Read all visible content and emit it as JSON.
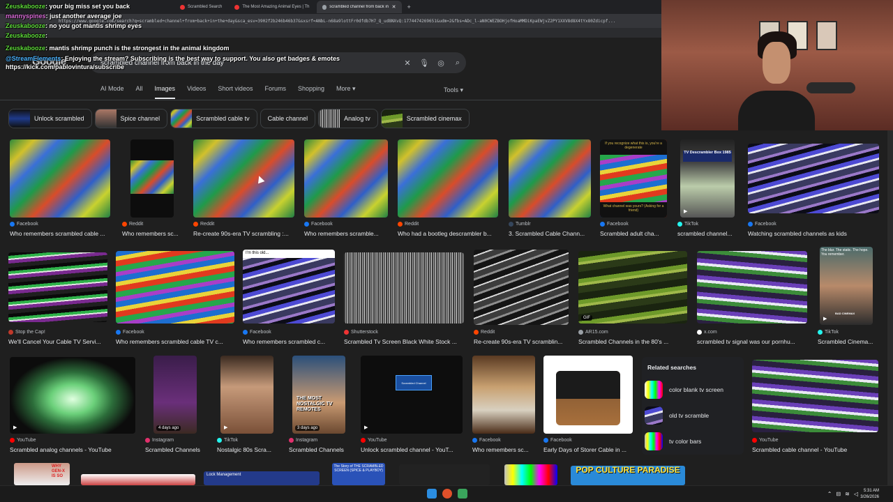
{
  "browser": {
    "tabs": [
      {
        "label": "Scrambled Search"
      },
      {
        "label": "The Most Amazing Animal Eyes | Th"
      },
      {
        "label": "scrambled channel from back in"
      }
    ],
    "url": "https://www.google.com/search?q=scrambled+channel+from+back+in+the+day&sca_esv=3902f2b246b46b37&sxsrf=ANbL-n68a9lottFr0dfdb7H7_Q_ud8NXvQ:1774474269651&udm=2&fbs=ADc_l-aN0CWEZBOHjofHoaMMDiKpaEWjvZ2PY1XXV8d8X4tYx80Zdicpf..."
  },
  "google": {
    "logo": "Google",
    "query": "scrambled channel from back in the day",
    "nav": [
      "AI Mode",
      "All",
      "Images",
      "Videos",
      "Short videos",
      "Forums",
      "Shopping",
      "More ▾"
    ],
    "tools": "Tools ▾",
    "chips": [
      "Unlock scrambled",
      "Spice channel",
      "Scrambled cable tv",
      "Cable channel",
      "Analog tv",
      "Scrambled cinemax"
    ]
  },
  "results": {
    "row1": [
      {
        "source": "Facebook",
        "title": "Who remembers scrambled cable ..."
      },
      {
        "source": "Reddit",
        "title": "Who remembers sc..."
      },
      {
        "source": "Reddit",
        "title": "Re-create 90s-era TV scrambling :..."
      },
      {
        "source": "Facebook",
        "title": "Who remembers scramble..."
      },
      {
        "source": "Reddit",
        "title": "Who had a bootleg descrambler b..."
      },
      {
        "source": "Tumblr",
        "title": "3. Scrambled Cable Chann..."
      },
      {
        "source": "Facebook",
        "title": "Scrambled adult cha..."
      },
      {
        "source": "TikTok",
        "title": "scrambled channel..."
      },
      {
        "source": "Facebook",
        "title": "Watching scrambled channels as kids"
      }
    ],
    "row2": [
      {
        "source": "Stop the Cap!",
        "title": "We'll Cancel Your Cable TV Servi..."
      },
      {
        "source": "Facebook",
        "title": "Who remembers scrambled cable TV c..."
      },
      {
        "source": "Facebook",
        "title": "Who remembers scrambled c..."
      },
      {
        "source": "Shutterstock",
        "title": "Scrambled Tv Screen Black White Stock ..."
      },
      {
        "source": "Reddit",
        "title": "Re-create 90s-era TV scramblin..."
      },
      {
        "source": "AR15.com",
        "title": "Scrambled Channels in the 80's ..."
      },
      {
        "source": "x.com",
        "title": "scrambled tv signal was our pornhu..."
      },
      {
        "source": "TikTok",
        "title": "Scrambled Cinema..."
      }
    ],
    "row3": [
      {
        "source": "YouTube",
        "title": "Scrambled analog channels - YouTube"
      },
      {
        "source": "Instagram",
        "title": "Scrambled Channels",
        "badge": "4 days ago"
      },
      {
        "source": "TikTok",
        "title": "Nostalgic 80s Scra..."
      },
      {
        "source": "Instagram",
        "title": "Scrambled Channels",
        "badge": "3 days ago"
      },
      {
        "source": "YouTube",
        "title": "Unlock scrambled channel - YouT..."
      },
      {
        "source": "Facebook",
        "title": "Who remembers sc..."
      },
      {
        "source": "Facebook",
        "title": "Early Days of Storer Cable in ..."
      },
      {
        "source": "YouTube",
        "title": "Scrambled cable channel - YouTube"
      }
    ],
    "gif_badge": "GIF",
    "image_text": {
      "adult_top": "If you recognize what this is, you're a degenerate",
      "adult_bottom": "What channel was yours? (Asking for a friend)",
      "descrambler": "TV Descrambler Box 1985",
      "meme": "I'm this old...",
      "unlock_btn": "Scrambled Channel",
      "nostalgic": "THE MOST NOSTALGIC TV REMOTES",
      "cinema_top": "The blur. The static. The hope. You remember.",
      "cinema_bottom": "BAD CINEMAX"
    }
  },
  "related": {
    "title": "Related searches",
    "items": [
      "color blank tv screen",
      "old tv scramble",
      "tv color bars"
    ]
  },
  "chat": [
    {
      "user": "Zeuskabooze",
      "text": "your big miss set you back"
    },
    {
      "user": "mannyspines",
      "text": "just another average joe"
    },
    {
      "user": "Zeuskabooze",
      "text": "no you got mantis shrimp eyes"
    },
    {
      "user": "Zeuskabooze",
      "text": ""
    },
    {
      "user": "Zeuskabooze",
      "text": "mantis shrimp punch is the strongest in the animal kingdom"
    },
    {
      "user": "@StreamElements",
      "text": "Enjoying the stream? Subscribing is the best way to support. You also get badges & emotes https://kick.com/pablovintura/subscribe"
    }
  ],
  "bottom_row": {
    "lock_text": "Lock Management",
    "story_text": "The Story of THE SCRAMBLED SCREEN (SPICE & PLAYBOY)",
    "pop_text": "POP CULTURE PARADISE",
    "genx_text": "WHY GEN-X IS SO"
  },
  "taskbar": {
    "time": "5:31 AM",
    "date": "3/26/2026"
  },
  "colors": {
    "facebook": "#1877f2",
    "reddit": "#ff4500",
    "youtube": "#ff0000",
    "instagram": "#e1306c",
    "tiktok": "#25f4ee"
  }
}
